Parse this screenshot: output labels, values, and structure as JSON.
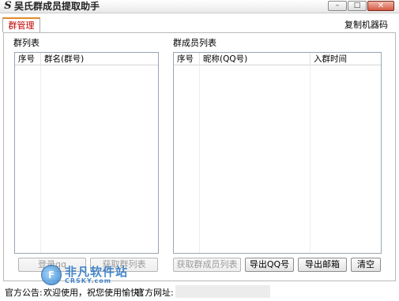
{
  "window": {
    "app_icon_glyph": "S",
    "title": "吴氏群成员提取助手",
    "minimize_glyph": "–",
    "maximize_glyph": "□",
    "close_glyph": "✕"
  },
  "tabs": [
    {
      "label": "群管理",
      "active": true
    }
  ],
  "header": {
    "copy_machine_code": "复制机器码"
  },
  "group_list": {
    "title": "群列表",
    "columns": [
      "序号",
      "群名(群号)"
    ],
    "rows": []
  },
  "member_list": {
    "title": "群成员列表",
    "columns": [
      "序号",
      "昵称(QQ号)",
      "入群时间"
    ],
    "rows": []
  },
  "buttons": {
    "login_qq": "登录qq",
    "get_group_list": "获取群列表",
    "get_member_list": "获取群成员列表",
    "export_qq": "导出QQ号",
    "export_email": "导出邮箱",
    "clear": "清空"
  },
  "status": {
    "notice_label": "官方公告:",
    "notice_text": "欢迎使用，祝您使用愉快！",
    "site_label": "官方网址:"
  },
  "watermark": {
    "logo_glyph": "F",
    "text_cn": "非凡软件站",
    "text_en": "CRSKY.com"
  },
  "colors": {
    "active_tab_text": "#c00000",
    "active_tab_accent": "#e08b2a",
    "watermark_blue": "#1f6fc2"
  }
}
